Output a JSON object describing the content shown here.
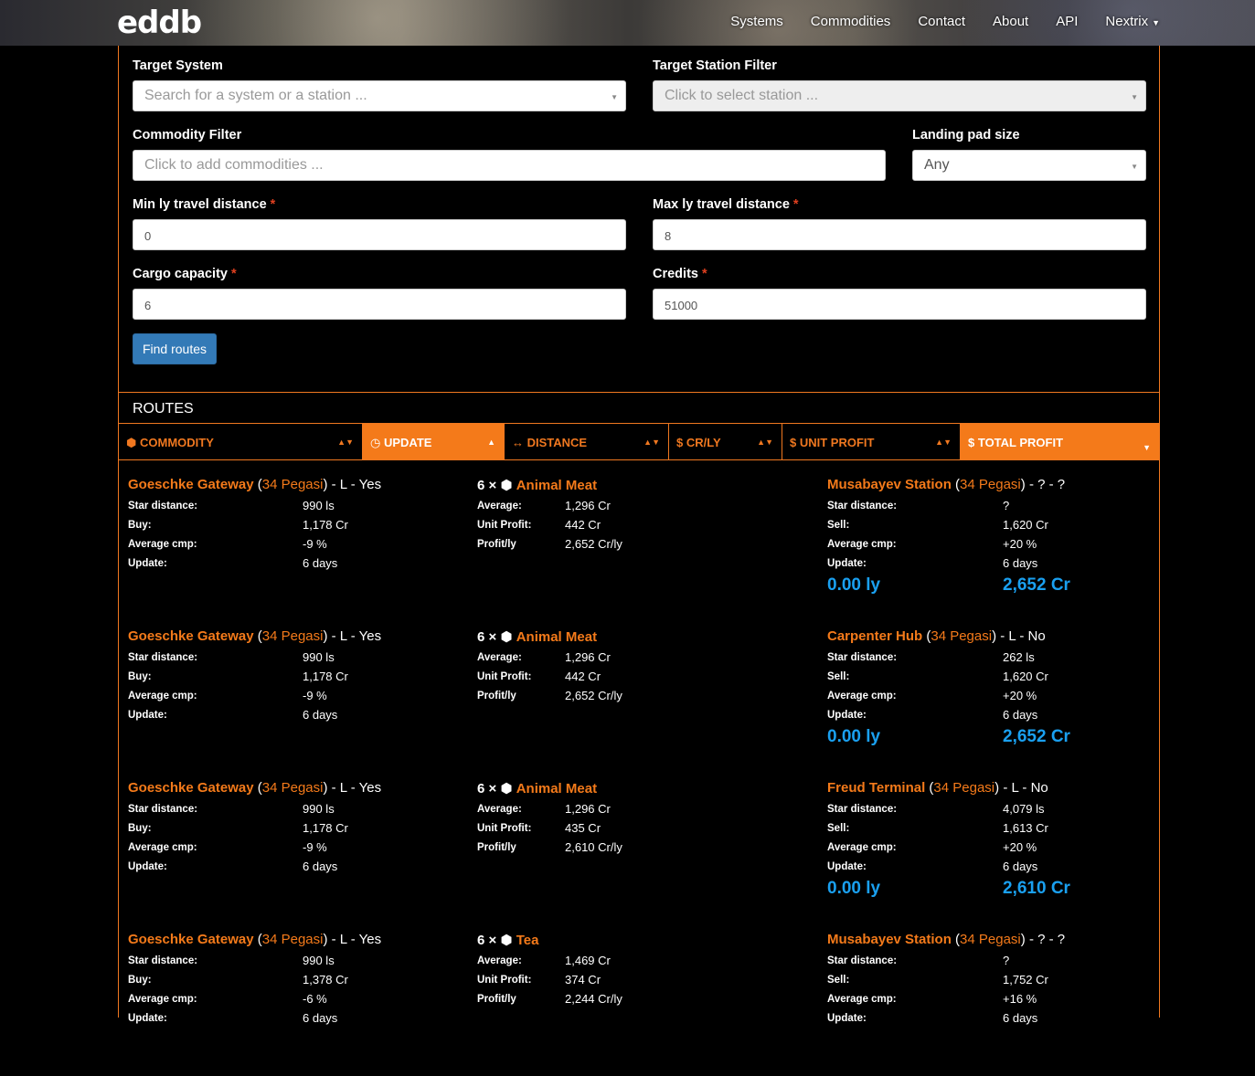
{
  "nav": {
    "logo": "eddb",
    "items": [
      "Systems",
      "Commodities",
      "Contact",
      "About",
      "API",
      "Nextrix"
    ]
  },
  "form": {
    "target_system": {
      "label": "Target System",
      "placeholder": "Search for a system or a station ..."
    },
    "target_station": {
      "label": "Target Station Filter",
      "placeholder": "Click to select station ..."
    },
    "commodity_filter": {
      "label": "Commodity Filter",
      "placeholder": "Click to add commodities ..."
    },
    "landing_pad": {
      "label": "Landing pad size",
      "value": "Any"
    },
    "min_ly": {
      "label": "Min ly travel distance",
      "value": "0"
    },
    "max_ly": {
      "label": "Max ly travel distance",
      "value": "8"
    },
    "cargo": {
      "label": "Cargo capacity",
      "value": "6"
    },
    "credits": {
      "label": "Credits",
      "value": "51000"
    },
    "required_mark": "*",
    "submit": "Find routes"
  },
  "routes": {
    "title": "ROUTES",
    "columns": [
      {
        "icon": "cube-icon",
        "label": "COMMODITY"
      },
      {
        "icon": "clock-icon",
        "label": "UPDATE"
      },
      {
        "icon": "arrows-icon",
        "label": "DISTANCE"
      },
      {
        "icon": "dollar-icon",
        "label": "CR/LY"
      },
      {
        "icon": "dollar-icon",
        "label": "UNIT PROFIT"
      },
      {
        "icon": "dollar-icon",
        "label": "TOTAL PROFIT"
      }
    ],
    "items": [
      {
        "from": {
          "station": "Goeschke Gateway",
          "system": "34 Pegasi",
          "suffix": "- L - Yes",
          "star_distance": "990 ls",
          "buy": "1,178 Cr",
          "average_cmp": "-9 %",
          "update": "6 days"
        },
        "commodity": {
          "qty": "6 ×",
          "name": "Animal Meat",
          "average": "1,296 Cr",
          "unit_profit": "442 Cr",
          "profit_ly": "2,652 Cr/ly"
        },
        "to": {
          "station": "Musabayev Station",
          "system": "34 Pegasi",
          "suffix": "- ? - ?",
          "star_distance": "?",
          "sell": "1,620 Cr",
          "average_cmp": "+20 %",
          "update": "6 days"
        },
        "distance": "0.00 ly",
        "total": "2,652 Cr"
      },
      {
        "from": {
          "station": "Goeschke Gateway",
          "system": "34 Pegasi",
          "suffix": "- L - Yes",
          "star_distance": "990 ls",
          "buy": "1,178 Cr",
          "average_cmp": "-9 %",
          "update": "6 days"
        },
        "commodity": {
          "qty": "6 ×",
          "name": "Animal Meat",
          "average": "1,296 Cr",
          "unit_profit": "442 Cr",
          "profit_ly": "2,652 Cr/ly"
        },
        "to": {
          "station": "Carpenter Hub",
          "system": "34 Pegasi",
          "suffix": "- L - No",
          "star_distance": "262 ls",
          "sell": "1,620 Cr",
          "average_cmp": "+20 %",
          "update": "6 days"
        },
        "distance": "0.00 ly",
        "total": "2,652 Cr"
      },
      {
        "from": {
          "station": "Goeschke Gateway",
          "system": "34 Pegasi",
          "suffix": "- L - Yes",
          "star_distance": "990 ls",
          "buy": "1,178 Cr",
          "average_cmp": "-9 %",
          "update": "6 days"
        },
        "commodity": {
          "qty": "6 ×",
          "name": "Animal Meat",
          "average": "1,296 Cr",
          "unit_profit": "435 Cr",
          "profit_ly": "2,610 Cr/ly"
        },
        "to": {
          "station": "Freud Terminal",
          "system": "34 Pegasi",
          "suffix": "- L - No",
          "star_distance": "4,079 ls",
          "sell": "1,613 Cr",
          "average_cmp": "+20 %",
          "update": "6 days"
        },
        "distance": "0.00 ly",
        "total": "2,610 Cr"
      },
      {
        "from": {
          "station": "Goeschke Gateway",
          "system": "34 Pegasi",
          "suffix": "- L - Yes",
          "star_distance": "990 ls",
          "buy": "1,378 Cr",
          "average_cmp": "-6 %",
          "update": "6 days"
        },
        "commodity": {
          "qty": "6 ×",
          "name": "Tea",
          "average": "1,469 Cr",
          "unit_profit": "374 Cr",
          "profit_ly": "2,244 Cr/ly"
        },
        "to": {
          "station": "Musabayev Station",
          "system": "34 Pegasi",
          "suffix": "- ? - ?",
          "star_distance": "?",
          "sell": "1,752 Cr",
          "average_cmp": "+16 %",
          "update": "6 days"
        },
        "distance": "",
        "total": ""
      }
    ],
    "keys": {
      "star_distance": "Star distance:",
      "buy": "Buy:",
      "sell": "Sell:",
      "average_cmp": "Average cmp:",
      "update": "Update:",
      "average": "Average:",
      "unit_profit": "Unit Profit:",
      "profit_ly": "Profit/ly"
    }
  }
}
